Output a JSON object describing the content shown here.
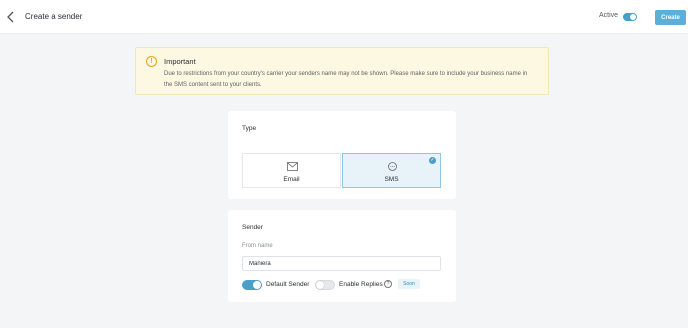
{
  "header": {
    "title": "Create a sender",
    "active_label": "Active",
    "active_on": true,
    "create_label": "Create"
  },
  "alert": {
    "title": "Important",
    "icon": "!",
    "text": "Due to restrictions from your country's carrier your senders name may not be shown. Please make sure to include your business name in the SMS content sent to your clients."
  },
  "type_card": {
    "title": "Type",
    "options": [
      {
        "label": "Email",
        "icon": "envelope-icon",
        "selected": false
      },
      {
        "label": "SMS",
        "icon": "chat-bubble-icon",
        "selected": true
      }
    ]
  },
  "sender_card": {
    "title": "Sender",
    "from_name_label": "From name",
    "from_name_value": "Maniera",
    "default_sender_label": "Default Sender",
    "default_sender_on": true,
    "enable_replies_label": "Enable Replies",
    "enable_replies_on": false,
    "help_glyph": "?",
    "soon_badge": "Soon"
  },
  "colors": {
    "accent": "#4a9fc8",
    "create_button": "#5cb0d8",
    "alert_bg": "#fdf8e1",
    "alert_icon": "#e3a51d",
    "page_bg": "#f4f5f7"
  }
}
